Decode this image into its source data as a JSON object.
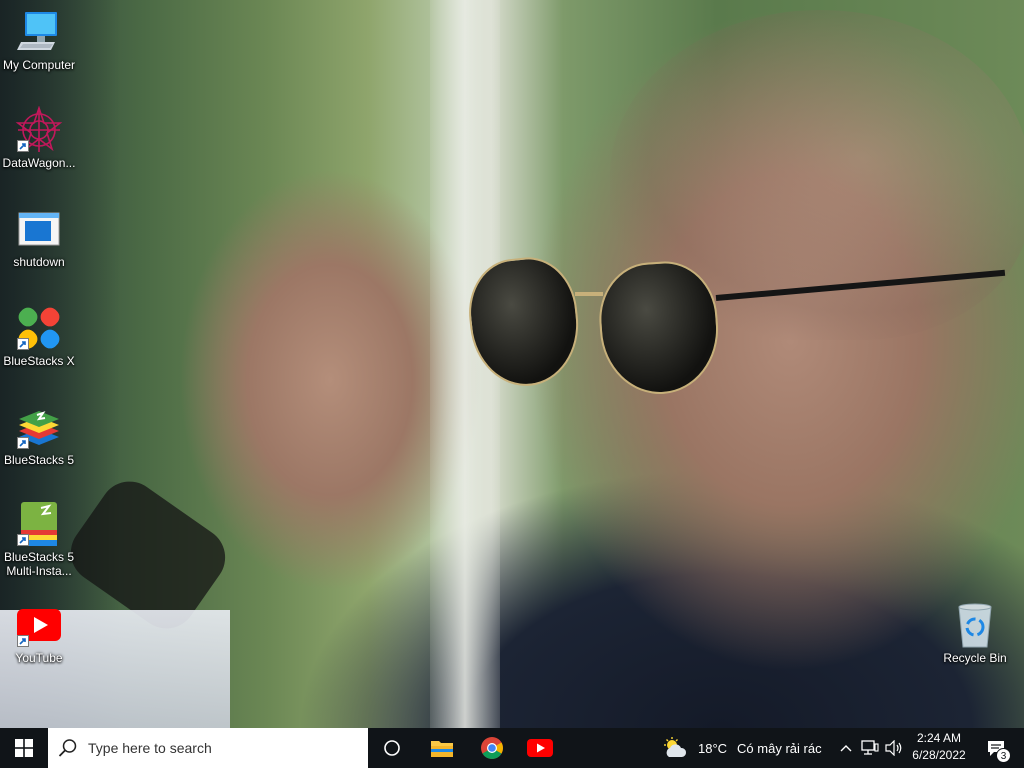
{
  "desktop": {
    "icons": [
      {
        "id": "my-computer",
        "label": "My Computer"
      },
      {
        "id": "datawagon",
        "label": "DataWagon..."
      },
      {
        "id": "shutdown",
        "label": "shutdown"
      },
      {
        "id": "bluestacks-x",
        "label": "BlueStacks X"
      },
      {
        "id": "bluestacks-5",
        "label": "BlueStacks 5"
      },
      {
        "id": "bluestacks-5-multi",
        "label": "BlueStacks 5 Multi-Insta..."
      },
      {
        "id": "youtube",
        "label": "YouTube"
      },
      {
        "id": "recycle-bin",
        "label": "Recycle Bin"
      }
    ]
  },
  "taskbar": {
    "start_icon": "windows-logo-icon",
    "search": {
      "placeholder": "Type here to search",
      "icon": "search-icon"
    },
    "pinned": [
      {
        "name": "task-view",
        "icon": "task-view-icon"
      },
      {
        "name": "file-explorer",
        "icon": "folder-icon"
      },
      {
        "name": "chrome",
        "icon": "chrome-icon"
      },
      {
        "name": "youtube",
        "icon": "youtube-icon"
      }
    ],
    "weather": {
      "temperature": "18°C",
      "condition": "Có mây rải rác",
      "icon": "partly-cloudy-icon"
    },
    "tray": {
      "icons": [
        "chevron-up-icon",
        "network-icon",
        "volume-icon"
      ],
      "time": "2:24 AM",
      "date": "6/28/2022",
      "notifications_count": "3"
    }
  },
  "colors": {
    "taskbar": "#101418",
    "search_box": "#ffffff",
    "youtube_red": "#ff0000"
  }
}
